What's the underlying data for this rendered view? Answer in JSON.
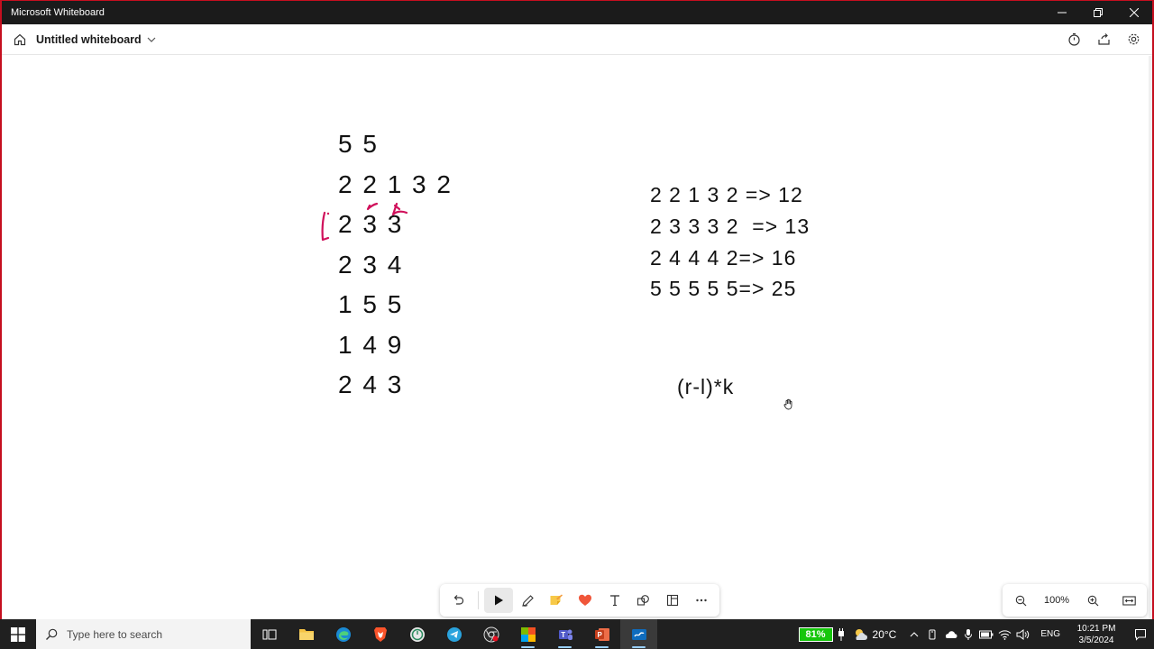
{
  "window": {
    "app_title": "Microsoft Whiteboard",
    "board_title": "Untitled whiteboard"
  },
  "canvas": {
    "left_lines": [
      "5 5",
      "2 2 1 3 2",
      "2 3 3",
      "2 3 4",
      "1 5 5",
      "1 4 9",
      "2 4 3"
    ],
    "right_lines": [
      "2 2 1 3 2 => 12",
      "2 3 3 3 2  => 13",
      "2 4 4 4 2=> 16",
      "5 5 5 5 5=> 25"
    ],
    "formula": "(r-l)*k",
    "ink_color": "#111111",
    "annotation_color": "#d0115b"
  },
  "zoom": {
    "level": "100%"
  },
  "taskbar": {
    "search_placeholder": "Type here to search",
    "battery": "81%",
    "temperature": "20°C",
    "language": "ENG",
    "time": "10:21 PM",
    "date": "3/5/2024"
  },
  "colors": {
    "frame": "#c50f1f",
    "titlebar": "#1b1b1b",
    "taskbar": "#202020",
    "battery": "#16c60c"
  }
}
